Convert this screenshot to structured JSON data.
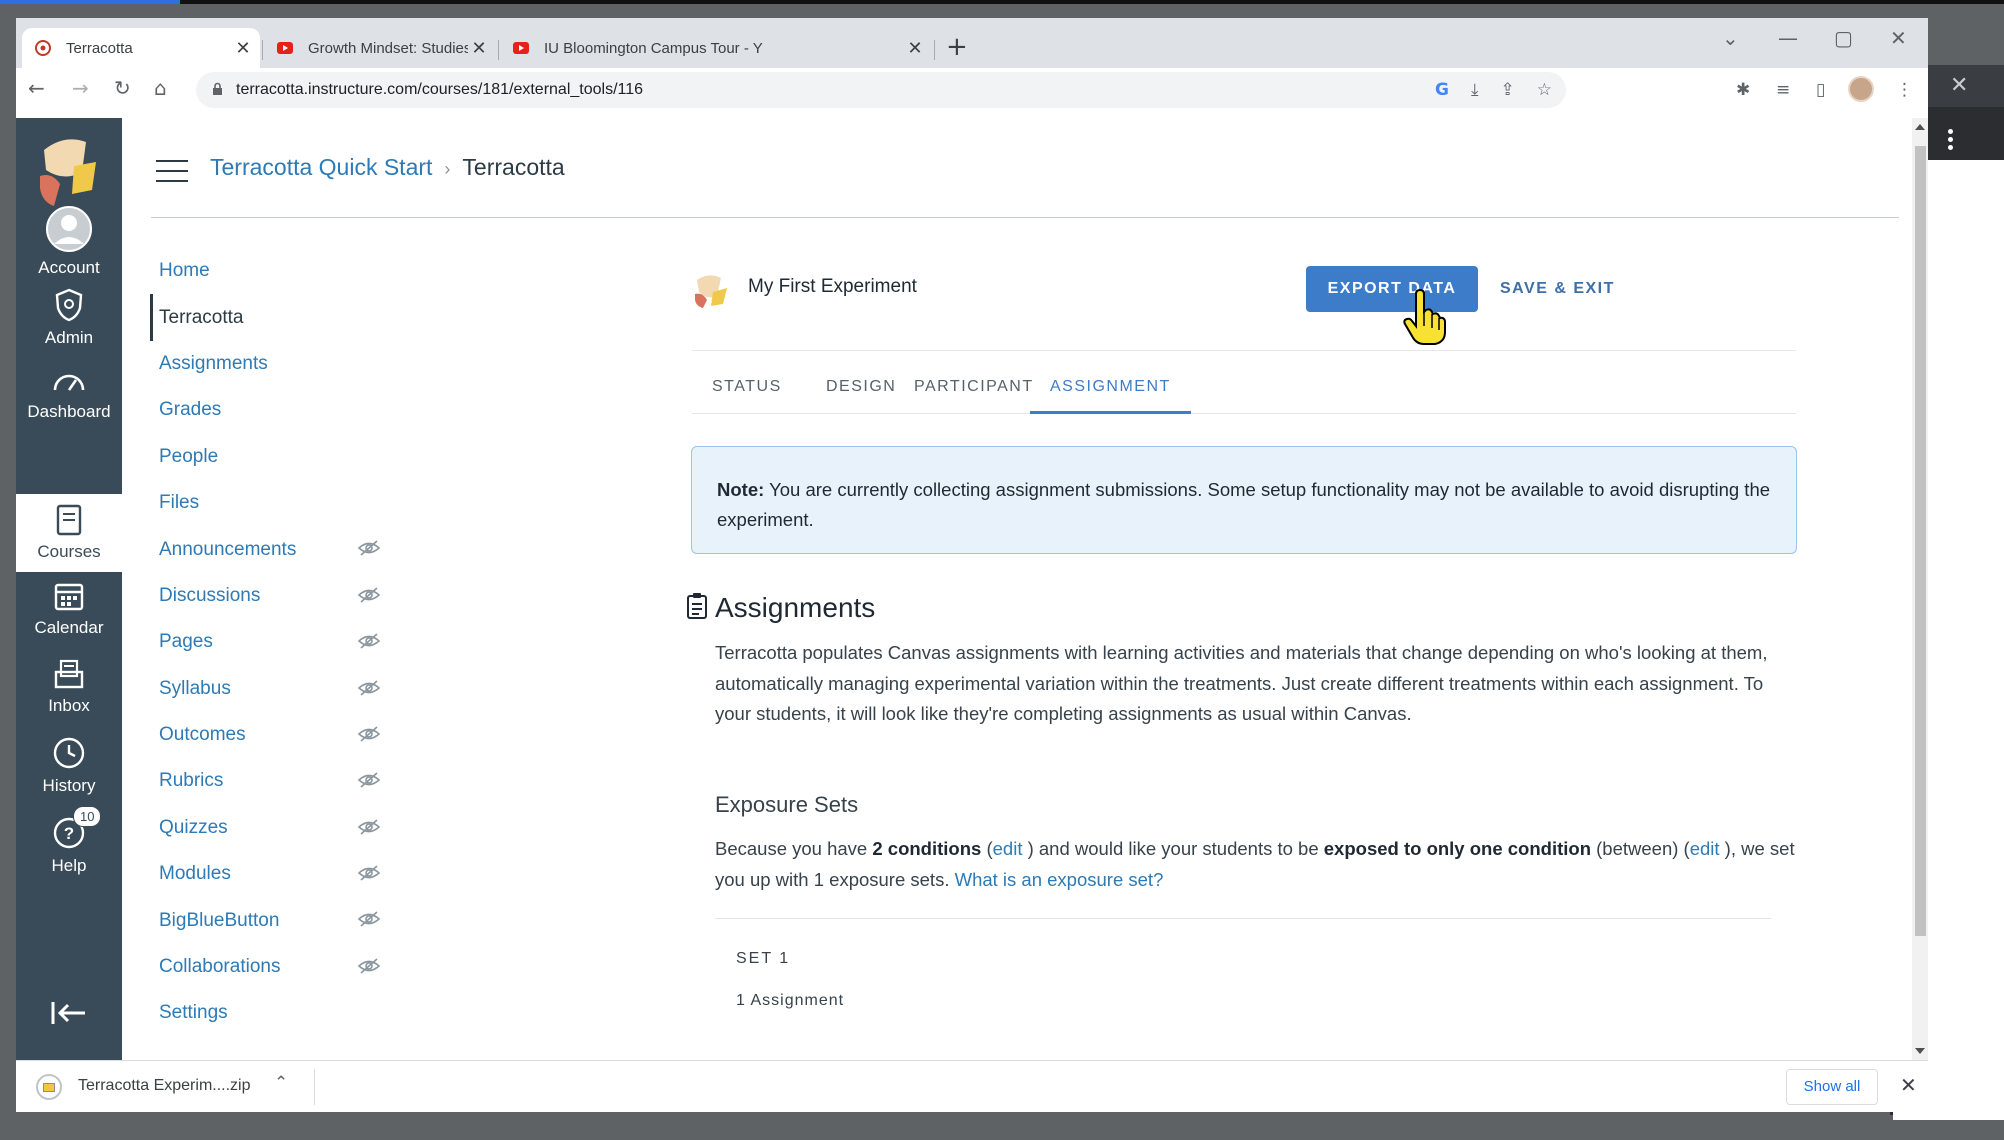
{
  "browser": {
    "tabs": [
      {
        "title": "Terracotta",
        "active": true
      },
      {
        "title": "Growth Mindset: Studies showing",
        "active": false
      },
      {
        "title": "IU Bloomington Campus Tour - Y",
        "active": false
      }
    ],
    "url": "terracotta.instructure.com/courses/181/external_tools/116"
  },
  "global_nav": {
    "items": [
      {
        "label": "Account",
        "icon": "account-icon"
      },
      {
        "label": "Admin",
        "icon": "admin-shield-icon"
      },
      {
        "label": "Dashboard",
        "icon": "dashboard-icon"
      },
      {
        "label": "Courses",
        "icon": "courses-book-icon",
        "active": true
      },
      {
        "label": "Calendar",
        "icon": "calendar-icon"
      },
      {
        "label": "Inbox",
        "icon": "inbox-icon"
      },
      {
        "label": "History",
        "icon": "history-clock-icon"
      },
      {
        "label": "Help",
        "icon": "help-icon",
        "badge": "10"
      }
    ]
  },
  "breadcrumb": {
    "course": "Terracotta Quick Start",
    "current": "Terracotta"
  },
  "course_nav": [
    {
      "label": "Home",
      "hidden": false
    },
    {
      "label": "Terracotta",
      "hidden": false,
      "active": true
    },
    {
      "label": "Assignments",
      "hidden": false
    },
    {
      "label": "Grades",
      "hidden": false
    },
    {
      "label": "People",
      "hidden": false
    },
    {
      "label": "Files",
      "hidden": false
    },
    {
      "label": "Announcements",
      "hidden": true
    },
    {
      "label": "Discussions",
      "hidden": true
    },
    {
      "label": "Pages",
      "hidden": true
    },
    {
      "label": "Syllabus",
      "hidden": true
    },
    {
      "label": "Outcomes",
      "hidden": true
    },
    {
      "label": "Rubrics",
      "hidden": true
    },
    {
      "label": "Quizzes",
      "hidden": true
    },
    {
      "label": "Modules",
      "hidden": true
    },
    {
      "label": "BigBlueButton",
      "hidden": true
    },
    {
      "label": "Collaborations",
      "hidden": true
    },
    {
      "label": "Settings",
      "hidden": false
    }
  ],
  "experiment": {
    "title": "My First Experiment",
    "export_label": "EXPORT DATA",
    "save_label": "SAVE & EXIT",
    "tabs": [
      "STATUS",
      "DESIGN",
      "PARTICIPANT",
      "ASSIGNMENT"
    ],
    "active_tab": "ASSIGNMENT"
  },
  "note": {
    "label": "Note:",
    "text": "You are currently collecting assignment submissions. Some setup functionality may not be available to avoid disrupting the experiment."
  },
  "assignments": {
    "heading": "Assignments",
    "body": "Terracotta populates Canvas assignments with learning activities and materials that change depending on who's looking at them, automatically managing experimental variation within the treatments. Just create different treatments within each assignment. To your students, it will look like they're completing assignments as usual within Canvas."
  },
  "exposure": {
    "heading": "Exposure Sets",
    "t1": "Because you have ",
    "b1": "2 conditions",
    "t2": " (",
    "edit1": "edit",
    "t3": " ) and would like your students to be ",
    "b2": "exposed to only one condition",
    "t4": " (between) (",
    "edit2": "edit",
    "t5": " ), we set you up with 1 exposure sets. ",
    "link": "What is an exposure set?"
  },
  "set": {
    "label": "SET 1",
    "count": "1 Assignment"
  },
  "download": {
    "file": "Terracotta Experim....zip",
    "show_all": "Show all"
  },
  "colors": {
    "canvas_nav": "#394b58",
    "link": "#2d7ab5",
    "primary_button": "#3d7cc9",
    "note_bg": "#e8f2fb"
  }
}
